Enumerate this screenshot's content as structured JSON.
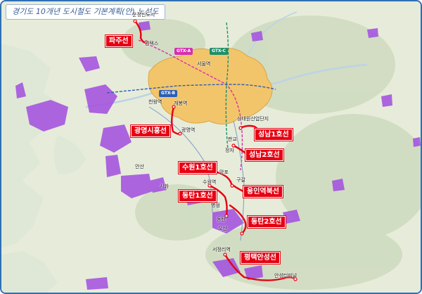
{
  "title": "경기도 10개년 도시철도 기본계획(안) 노선도",
  "colors": {
    "sea": "#dfe8d6",
    "land": "#e6ecd9",
    "forest": "#cfdcc0",
    "urban_seoul": "#f3c56a",
    "industrial": "#a24de0",
    "plan_line": "#e60012",
    "gtx_a": "#d62fb0",
    "gtx_b": "#2b5fb5",
    "gtx_c": "#1f8f6a",
    "frame": "#2f6fb5"
  },
  "lines": [
    {
      "id": "paju",
      "label": "파주선"
    },
    {
      "id": "gwangmyeong-siheung",
      "label": "광명시흥선"
    },
    {
      "id": "seongnam-1",
      "label": "성남1호선"
    },
    {
      "id": "seongnam-2",
      "label": "성남2호선"
    },
    {
      "id": "suwon-1",
      "label": "수원1호선"
    },
    {
      "id": "yongin-yeokbuk",
      "label": "용인역북선"
    },
    {
      "id": "dongtan-1",
      "label": "동탄1호선"
    },
    {
      "id": "dongtan-2",
      "label": "동탄2호선"
    },
    {
      "id": "pyeongtaek-anseong",
      "label": "평택안성선"
    }
  ],
  "gtx_tags": {
    "a_top": "GTX-A",
    "c_top": "GTX-C",
    "b_west": "GTX-B"
  },
  "places": {
    "unjeong": "운정신도시",
    "lakepark": "킨텍스",
    "seoul_center": "서울역",
    "cheonwang": "천왕역",
    "gaebong": "개봉역",
    "gwangmyeong": "광명역",
    "sangdaewon": "상대원산업단지",
    "hanjeong": "판교",
    "jeongja": "정자",
    "ansan": "안산",
    "siheung": "시화",
    "suwon_st": "수원역",
    "mangpo": "망포",
    "gugal": "구갈",
    "giheung": "기흥",
    "byeongjeom": "병점",
    "dongtan": "동탄",
    "osan": "오산",
    "seojeong": "서정리역",
    "anseong_terminal": "안성터미널",
    "yongsan": "용산"
  }
}
